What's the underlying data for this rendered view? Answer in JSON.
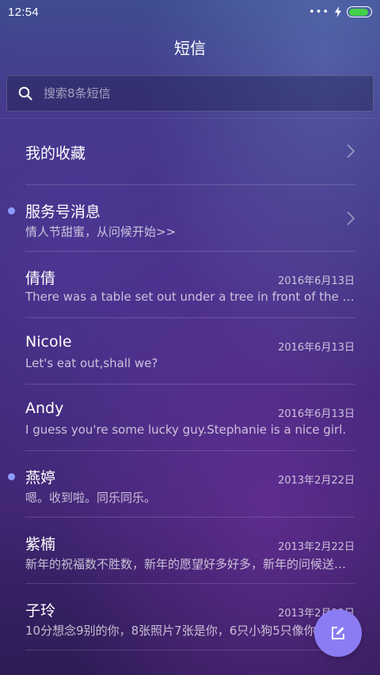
{
  "status_bar": {
    "time": "12:54",
    "overflow_dots": "•••",
    "battery_level": 0.9,
    "battery_color": "#44d04a"
  },
  "header": {
    "title": "短信"
  },
  "search": {
    "placeholder": "搜索8条短信",
    "value": ""
  },
  "favorites": {
    "label": "我的收藏"
  },
  "service": {
    "title": "服务号消息",
    "preview": "情人节甜蜜，从问候开始>>",
    "unread": true
  },
  "messages": [
    {
      "name": "倩倩",
      "date": "2016年6月13日",
      "preview": "There was a table set out under a tree in front of the house",
      "unread": false
    },
    {
      "name": "Nicole",
      "date": "2016年6月13日",
      "preview": "Let's eat out,shall we?",
      "unread": false
    },
    {
      "name": "Andy",
      "date": "2016年6月13日",
      "preview": "I guess you're some lucky guy.Stephanie is a nice girl.",
      "unread": false
    },
    {
      "name": "燕婷",
      "date": "2013年2月22日",
      "preview": "嗯。收到啦。同乐同乐。",
      "unread": true
    },
    {
      "name": "紫楠",
      "date": "2013年2月22日",
      "preview": "新年的祝福数不胜数，新年的愿望好多好多，新年的问候送给你",
      "unread": false
    },
    {
      "name": "子玲",
      "date": "2013年2月22日",
      "preview": "10分想念9别的你，8张照片7张是你，6只小狗5只像你",
      "unread": false
    }
  ],
  "colors": {
    "accent": "#8c7cf4",
    "unread_dot": "#8c9cff"
  },
  "icons": {
    "search": "search-icon",
    "chevron": "chevron-right-icon",
    "compose": "compose-icon",
    "charging": "bolt-icon"
  }
}
